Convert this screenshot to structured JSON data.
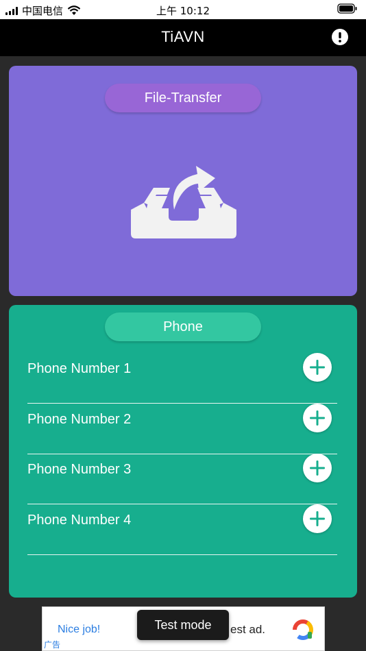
{
  "status_bar": {
    "carrier": "中国电信",
    "time": "上午 10:12",
    "icons": [
      "signal-icon",
      "wifi-icon",
      "battery-icon"
    ]
  },
  "nav": {
    "title": "TiAVN",
    "info_icon": "exclamation-circle-icon"
  },
  "file_card": {
    "label": "File-Transfer",
    "icon": "inbox-share-icon",
    "color": "#7f6bd8"
  },
  "phone_card": {
    "label": "Phone",
    "color": "#17ae8e",
    "rows": [
      {
        "label": "Phone Number 1"
      },
      {
        "label": "Phone Number 2"
      },
      {
        "label": "Phone Number 3"
      },
      {
        "label": "Phone Number 4"
      }
    ],
    "add_icon": "plus-circle-icon"
  },
  "ad": {
    "nice": "Nice job!",
    "tag": "广告",
    "rest": "est ad.",
    "toast": "Test mode"
  }
}
